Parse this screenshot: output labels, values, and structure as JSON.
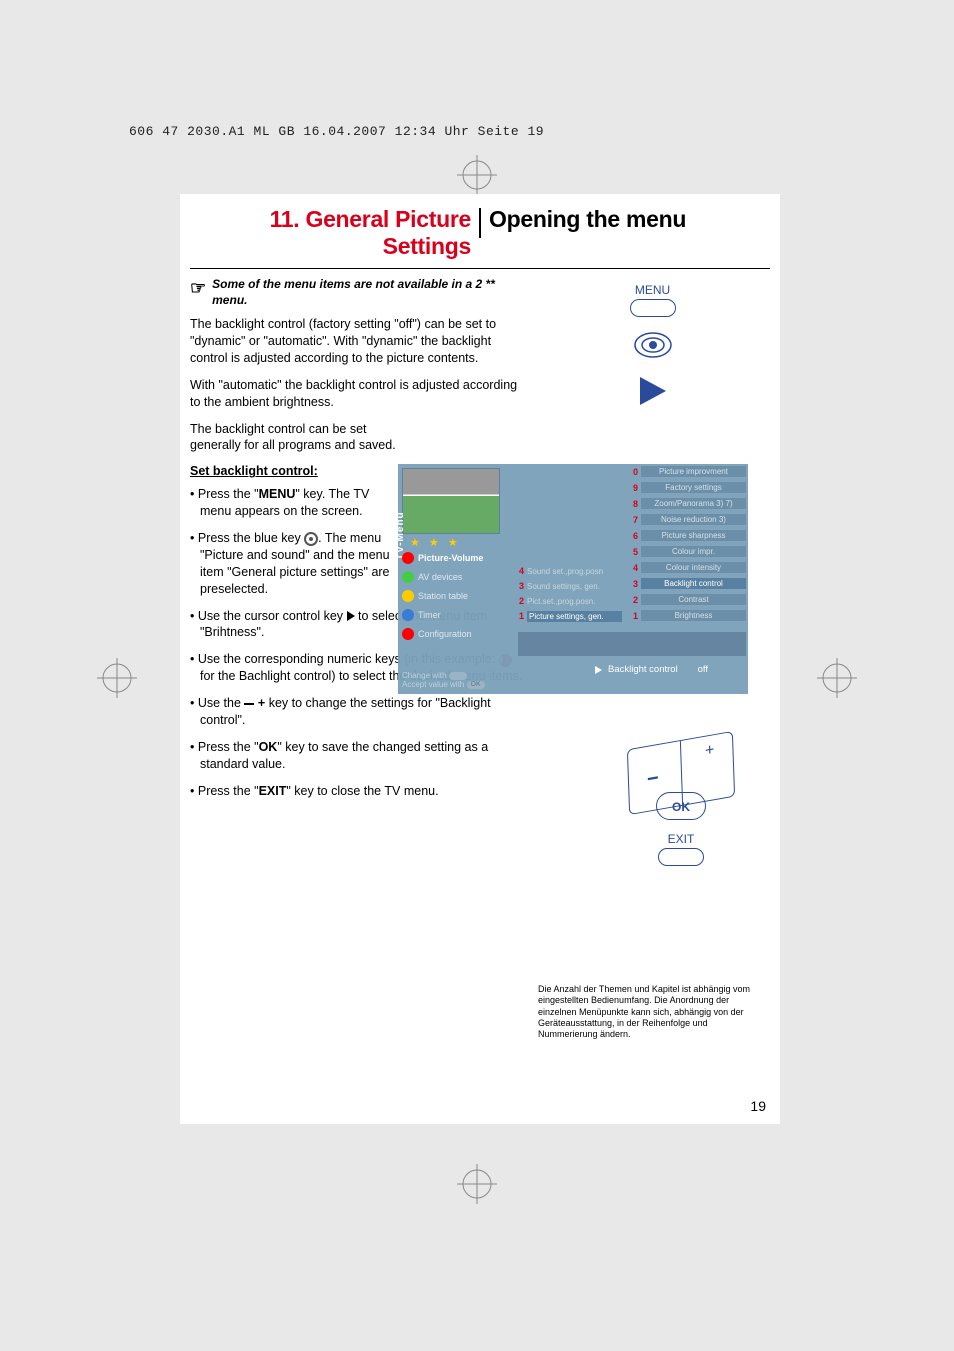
{
  "header_line": "606 47 2030.A1  ML GB  16.04.2007  12:34 Uhr  Seite 19",
  "title_left": "11. General Picture Settings",
  "title_right": "Opening the menu",
  "note_text": "Some of the menu items are not available in a 2 ** menu.",
  "para1": "The backlight control (factory setting \"off\") can be set to \"dynamic\" or \"automatic\". With \"dynamic\" the backlight control is adjusted according to the picture contents.",
  "para2": "With \"automatic\" the backlight control is adjusted according to the ambient brightness.",
  "para3": "The backlight control can be set generally for all programs and saved.",
  "subhead": "Set backlight control:",
  "bullets": {
    "b1a": "Press the \"",
    "b1b": "MENU",
    "b1c": "\" key. The TV menu appears on the screen.",
    "b2a": "Press the blue key ",
    "b2b": ". The menu \"Picture and sound\" and the menu item \"General picture settings\" are preselected.",
    "b3a": "Use the cursor control key ",
    "b3b": " to select the menu item \"Brihtness\".",
    "b4a": "Use the corresponding numeric keys (in this example: ",
    "b4_num": "3",
    "b4b": " for the Bachlight control) to select the desired menu items.",
    "b5a": "Use the ",
    "b5_plus": "+",
    "b5b": " key to change the settings for \"Backlight control\".",
    "b6a": "Press the \"",
    "b6b": "OK",
    "b6c": "\" key to save the changed setting as a standard value.",
    "b7a": "Press the \"",
    "b7b": "EXIT",
    "b7c": "\" key to close the TV menu."
  },
  "remote": {
    "menu": "MENU",
    "ok": "OK",
    "exit": "EXIT"
  },
  "osd": {
    "tvmenu": "TV-Menu",
    "side": [
      {
        "label": "Picture-Volume",
        "sel": true,
        "dot": "#ff0000"
      },
      {
        "label": "AV devices",
        "sel": false,
        "dot": "#44cc44"
      },
      {
        "label": "Station table",
        "sel": false,
        "dot": "#ffcc00"
      },
      {
        "label": "Timer",
        "sel": false,
        "dot": "#3a7bd5"
      },
      {
        "label": "Configuration",
        "sel": false,
        "dot": "#ff0000"
      }
    ],
    "mid": [
      {
        "num": "4",
        "label": "Sound set.,prog.posn"
      },
      {
        "num": "3",
        "label": "Sound settings, gen."
      },
      {
        "num": "2",
        "label": "Pict.set.,prog.posn."
      },
      {
        "num": "1",
        "label": "Picture settings, gen.",
        "sel": true
      }
    ],
    "right": [
      {
        "num": "0",
        "label": "Picture improvment"
      },
      {
        "num": "9",
        "label": "Factory settings"
      },
      {
        "num": "8",
        "label": "Zoom/Panorama 3) 7)"
      },
      {
        "num": "7",
        "label": "Noise reduction 3)"
      },
      {
        "num": "6",
        "label": "Picture sharpness"
      },
      {
        "num": "5",
        "label": "Colour impr."
      },
      {
        "num": "4",
        "label": "Colour intensity"
      },
      {
        "num": "3",
        "label": "Backlight control",
        "sel": true
      },
      {
        "num": "2",
        "label": "Contrast"
      },
      {
        "num": "1",
        "label": "Brightness"
      }
    ],
    "hint1": "Change with",
    "hint2": "Accept value with",
    "hint_ok": "OK",
    "status_label": "Backlight control",
    "status_value": "off"
  },
  "footnote": "Die Anzahl der Themen und Kapitel ist abhängig vom eingestellten Bedienumfang. Die Anordnung der einzelnen Menüpunkte kann sich, abhängig von der Geräteausstattung, in der Reihenfolge und Nummerierung ändern.",
  "page_num": "19"
}
